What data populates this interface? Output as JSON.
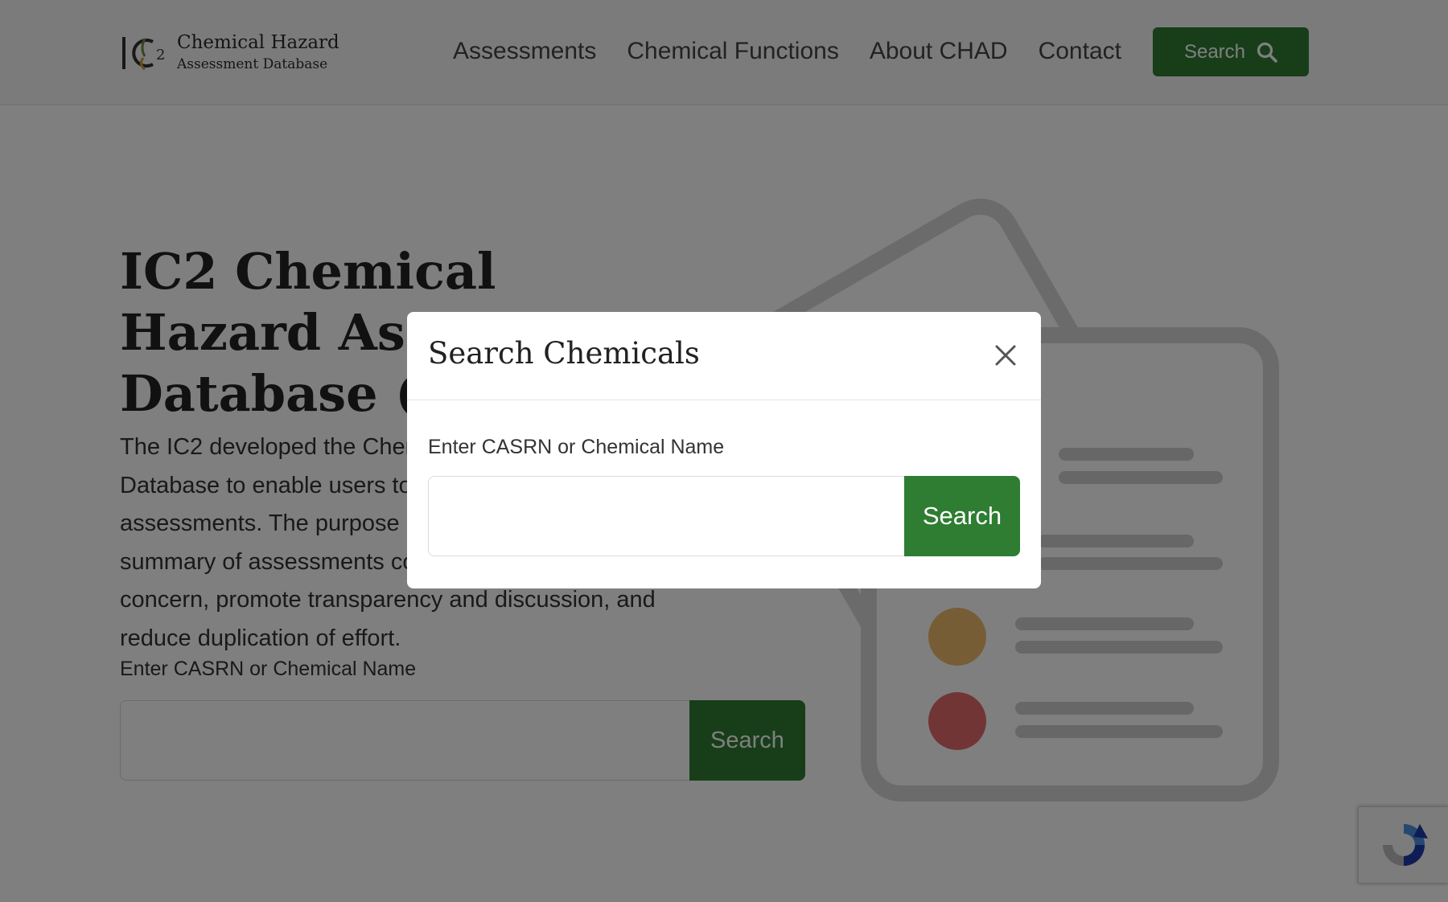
{
  "header": {
    "logo_mark": "IC2",
    "logo_title": "Chemical Hazard",
    "logo_subtitle": "Assessment Database",
    "nav": [
      {
        "label": "Assessments"
      },
      {
        "label": "Chemical Functions"
      },
      {
        "label": "About CHAD"
      },
      {
        "label": "Contact"
      }
    ],
    "search_button_label": "Search",
    "search_button_icon": "search-icon"
  },
  "hero": {
    "title": "IC2 Chemical Hazard Assessment Database (CHAD)",
    "description": "The IC2 developed the Chemical Hazard Assessment Database to enable users to search for GreenScreen assessments. The purpose of this tool is to provide a summary of assessments conducted on chemicals of concern, promote transparency and discussion, and reduce duplication of effort.",
    "search_label": "Enter CASRN or Chemical Name",
    "search_value": "",
    "search_button_label": "Search"
  },
  "modal": {
    "title": "Search Chemicals",
    "close_icon": "close-icon",
    "field_label": "Enter CASRN or Chemical Name",
    "field_value": "",
    "search_button_label": "Search"
  },
  "recaptcha": {
    "icon": "recaptcha-icon"
  },
  "colors": {
    "accent_green": "#2e7d32",
    "backdrop": "rgba(0,0,0,0.5)",
    "illustration_dot_1": "#e9a33c",
    "illustration_dot_2": "#d93a3a"
  }
}
